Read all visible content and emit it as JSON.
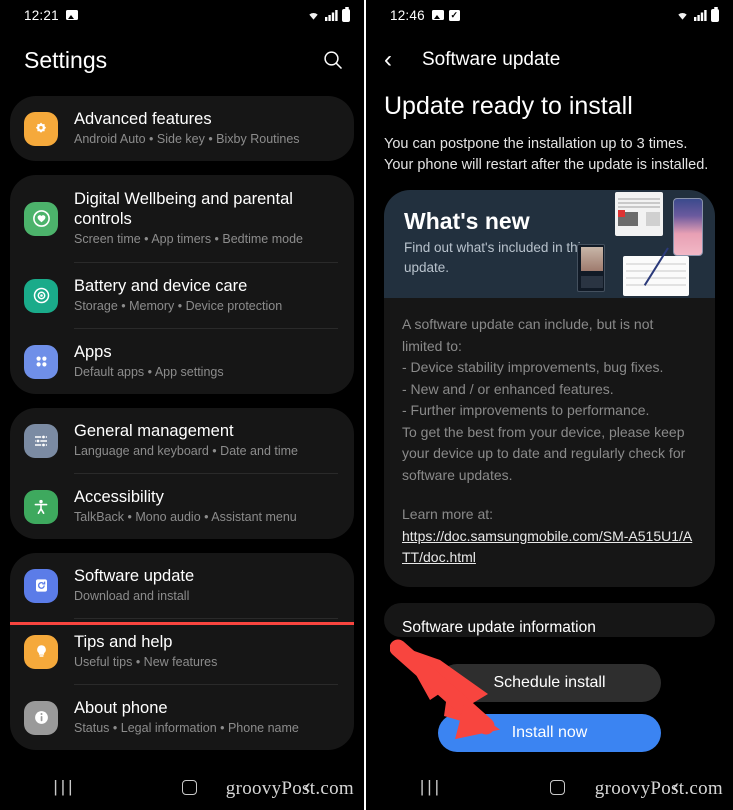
{
  "left_phone": {
    "status_bar": {
      "time": "12:21",
      "left_icons": [
        "image-icon"
      ],
      "right_icons": [
        "wifi-icon",
        "signal-icon",
        "battery-icon"
      ]
    },
    "header": {
      "title": "Settings",
      "search_icon": "search-icon"
    },
    "groups": [
      {
        "items": [
          {
            "icon": "gear-icon",
            "icon_color": "#f5a93b",
            "title": "Advanced features",
            "subtitle": "Android Auto  •  Side key  •  Bixby Routines"
          }
        ]
      },
      {
        "items": [
          {
            "icon": "wellbeing-icon",
            "icon_color": "#4cb36b",
            "title": "Digital Wellbeing and parental controls",
            "subtitle": "Screen time  •  App timers  •  Bedtime mode"
          },
          {
            "icon": "battery-care-icon",
            "icon_color": "#1aab8a",
            "title": "Battery and device care",
            "subtitle": "Storage  •  Memory  •  Device protection"
          },
          {
            "icon": "apps-icon",
            "icon_color": "#6f8fe8",
            "title": "Apps",
            "subtitle": "Default apps  •  App settings"
          }
        ]
      },
      {
        "items": [
          {
            "icon": "sliders-icon",
            "icon_color": "#7b8ba3",
            "title": "General management",
            "subtitle": "Language and keyboard  •  Date and time"
          },
          {
            "icon": "accessibility-icon",
            "icon_color": "#3ea95e",
            "title": "Accessibility",
            "subtitle": "TalkBack  •  Mono audio  •  Assistant menu"
          }
        ]
      },
      {
        "highlighted": true,
        "items": [
          {
            "icon": "software-update-icon",
            "icon_color": "#5b7ce8",
            "title": "Software update",
            "subtitle": "Download and install"
          },
          {
            "icon": "lightbulb-icon",
            "icon_color": "#f5a93b",
            "title": "Tips and help",
            "subtitle": "Useful tips  •  New features"
          },
          {
            "icon": "info-icon",
            "icon_color": "#9a9a9a",
            "title": "About phone",
            "subtitle": "Status  •  Legal information  •  Phone name"
          }
        ]
      }
    ],
    "nav_bar": {
      "recents": "|||",
      "home": "home-icon",
      "back": "‹"
    },
    "watermark": "groovyPost.com"
  },
  "right_phone": {
    "status_bar": {
      "time": "12:46",
      "left_icons": [
        "image-icon",
        "checkbox-icon"
      ],
      "right_icons": [
        "wifi-icon",
        "signal-icon",
        "battery-icon"
      ]
    },
    "header": {
      "back_icon": "chevron-left-icon",
      "title": "Software update"
    },
    "heading": "Update ready to install",
    "description": "You can postpone the installation up to 3 times. Your phone will restart after the update is installed.",
    "whats_new": {
      "title": "What's new",
      "subtitle": "Find out what's included in this update.",
      "background_color": "#22303e",
      "thumbnails": [
        "document-thumbnail",
        "phone-home-thumbnail",
        "flip-phone-thumbnail",
        "tablet-stylus-thumbnail"
      ]
    },
    "info_paragraph": "A software update can include, but is not limited to:\n - Device stability improvements, bug fixes.\n - New and / or enhanced features.\n - Further improvements to performance.\nTo get the best from your device, please keep your device up to date and regularly check for software updates.",
    "learn_more_label": "Learn more at:",
    "learn_more_url": "https://doc.samsungmobile.com/SM-A515U1/ATT/doc.html",
    "software_update_information_title": "Software update information",
    "buttons": {
      "schedule_label": "Schedule install",
      "install_label": "Install now",
      "install_color": "#3b84f2"
    },
    "nav_bar": {
      "recents": "|||",
      "home": "home-icon",
      "back": "‹"
    },
    "watermark": "groovyPost.com"
  },
  "annotations": {
    "highlight_color": "#f8453f",
    "arrow_color": "#f8453f",
    "arrow_target": "Install now"
  }
}
